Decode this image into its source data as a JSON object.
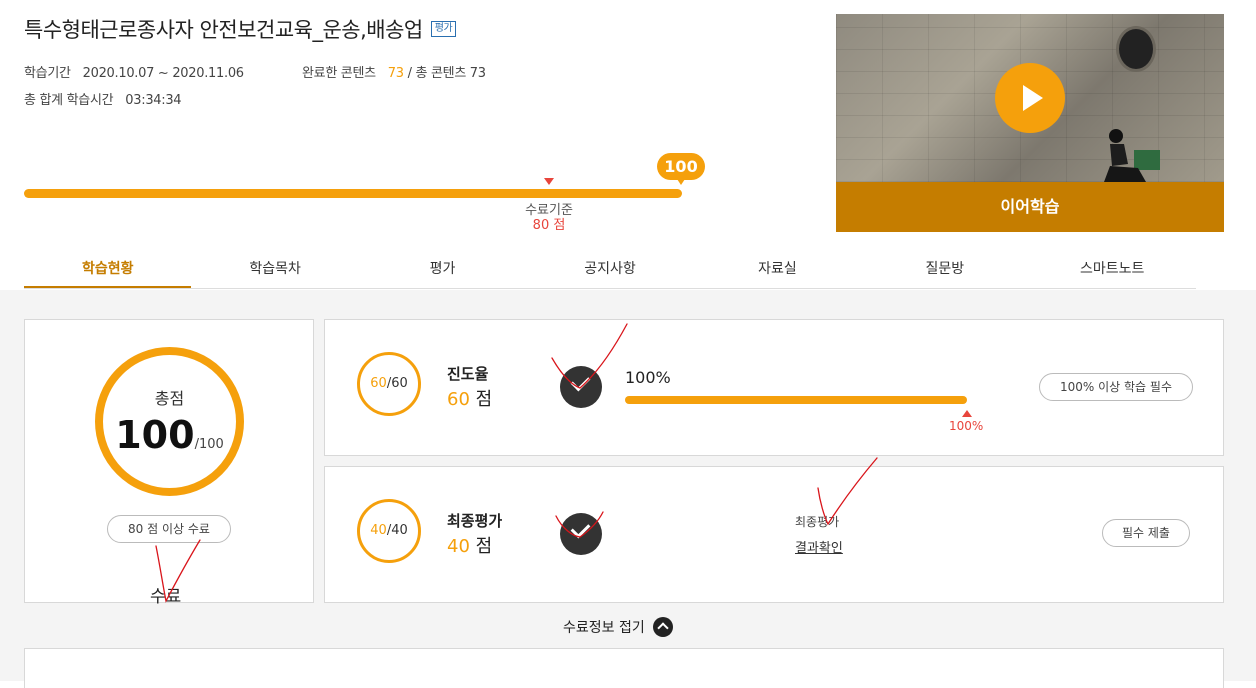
{
  "course": {
    "title": "특수형태근로종사자 안전보건교육_운송,배송업",
    "tag": "평가"
  },
  "meta": {
    "period_label": "학습기간",
    "period_value": "2020.10.07 ~ 2020.11.06",
    "completed_label": "완료한 콘텐츠",
    "completed_value": "73",
    "total_label": "/ 총 콘텐츠 73",
    "time_label": "총 합계 학습시간",
    "time_value": "03:34:34"
  },
  "progress": {
    "value": 100,
    "bubble": "100",
    "criteria_label": "수료기준",
    "criteria_value": "80 점"
  },
  "video": {
    "resume_label": "이어학습"
  },
  "tabs": [
    {
      "label": "학습현황",
      "active": true
    },
    {
      "label": "학습목차",
      "active": false
    },
    {
      "label": "평가",
      "active": false
    },
    {
      "label": "공지사항",
      "active": false
    },
    {
      "label": "자료실",
      "active": false
    },
    {
      "label": "질문방",
      "active": false
    },
    {
      "label": "스마트노트",
      "active": false
    }
  ],
  "score": {
    "label": "총점",
    "value": "100",
    "max": "/100",
    "requirement": "80 점 이상 수료",
    "status": "수료"
  },
  "cards": {
    "progress": {
      "got": "60",
      "max": "/60",
      "title": "진도율",
      "score": "60",
      "unit": "점",
      "percent_label": "100%",
      "percent": 100,
      "mark_label": "100%",
      "requirement": "100% 이상 학습 필수"
    },
    "final": {
      "got": "40",
      "max": "/40",
      "title": "최종평가",
      "score": "40",
      "unit": "점",
      "eval_label": "최종평가",
      "result_link": "결과확인",
      "requirement": "필수 제출"
    }
  },
  "fold_label": "수료정보 접기",
  "colors": {
    "accent": "#f5a00c",
    "brand_dark": "#c57d00",
    "alert": "#e8453c"
  }
}
